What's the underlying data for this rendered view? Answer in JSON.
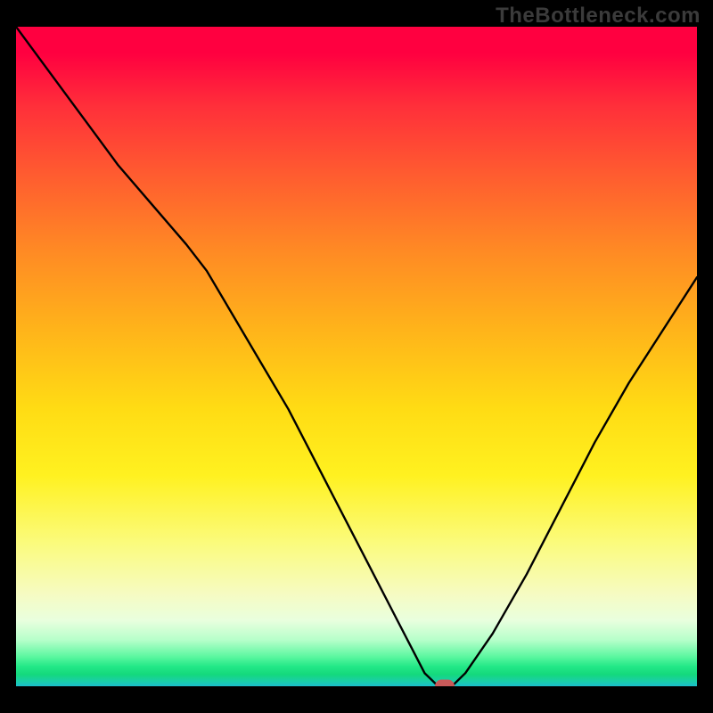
{
  "watermark": "TheBottleneck.com",
  "colors": {
    "frame_bg": "#000000",
    "marker": "#c85a5a",
    "curve": "#000000"
  },
  "chart_data": {
    "type": "line",
    "title": "",
    "xlabel": "",
    "ylabel": "",
    "xlim": [
      0,
      100
    ],
    "ylim": [
      0,
      100
    ],
    "grid": false,
    "legend": false,
    "series": [
      {
        "name": "bottleneck-curve",
        "x": [
          0,
          5,
          10,
          15,
          20,
          25,
          28,
          32,
          36,
          40,
          44,
          48,
          52,
          56,
          58,
          60,
          62,
          64,
          66,
          70,
          75,
          80,
          85,
          90,
          95,
          100
        ],
        "values": [
          100,
          93,
          86,
          79,
          73,
          67,
          63,
          56,
          49,
          42,
          34,
          26,
          18,
          10,
          6,
          2,
          0,
          0,
          2,
          8,
          17,
          27,
          37,
          46,
          54,
          62
        ]
      }
    ],
    "marker": {
      "x": 63,
      "y": 0
    },
    "gradient_stops": [
      {
        "pos": 0.0,
        "color": "#ff0040"
      },
      {
        "pos": 0.22,
        "color": "#ff5a30"
      },
      {
        "pos": 0.46,
        "color": "#ffb41a"
      },
      {
        "pos": 0.68,
        "color": "#fff120"
      },
      {
        "pos": 0.86,
        "color": "#f6fbc2"
      },
      {
        "pos": 0.93,
        "color": "#b6ffca"
      },
      {
        "pos": 0.97,
        "color": "#23e887"
      },
      {
        "pos": 1.0,
        "color": "#1bbecb"
      }
    ]
  }
}
